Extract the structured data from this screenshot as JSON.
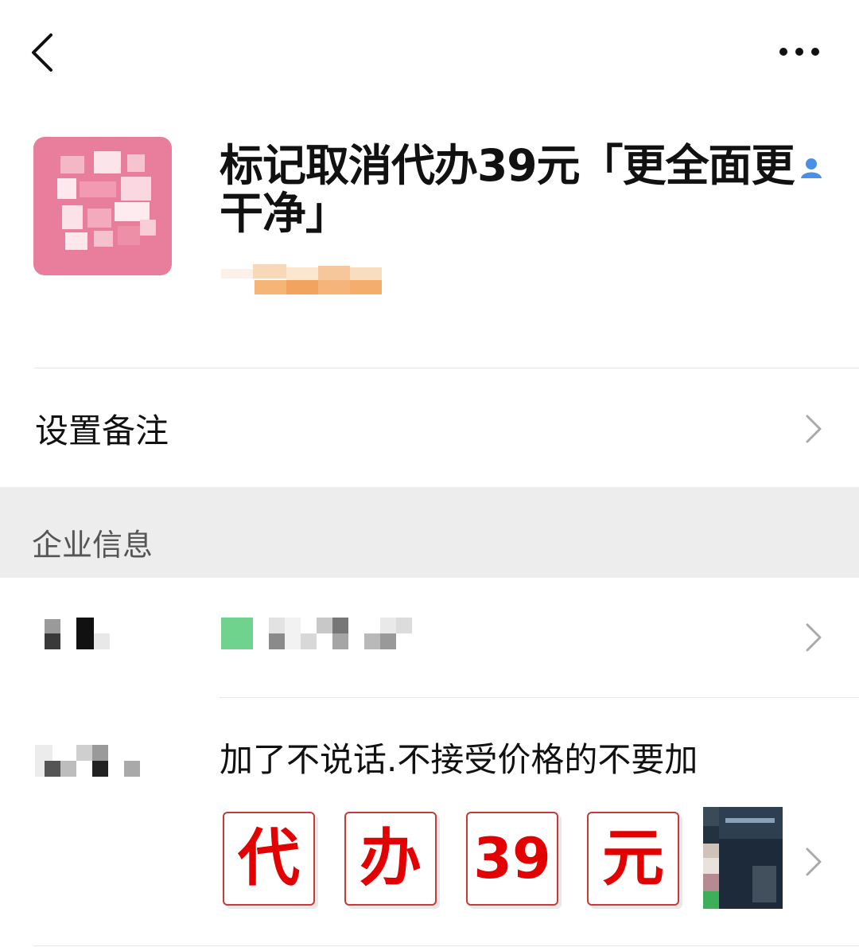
{
  "header": {
    "title": "标记取消代办39元「更全面更干净」"
  },
  "remark": {
    "label": "设置备注"
  },
  "section": {
    "title": "企业信息"
  },
  "enterprise": {
    "description": "加了不说话.不接受价格的不要加",
    "thumbnails": [
      "代",
      "办",
      "39",
      "元"
    ]
  },
  "colors": {
    "avatar": "#e97e9c",
    "section_bg": "#ededed",
    "thumb_text": "#e30000",
    "contact_icon": "#4a8fe8"
  },
  "icons": {
    "back": "chevron-left-icon",
    "more": "more-dots-icon",
    "contact": "contact-person-icon",
    "chevron": "chevron-right-icon"
  }
}
